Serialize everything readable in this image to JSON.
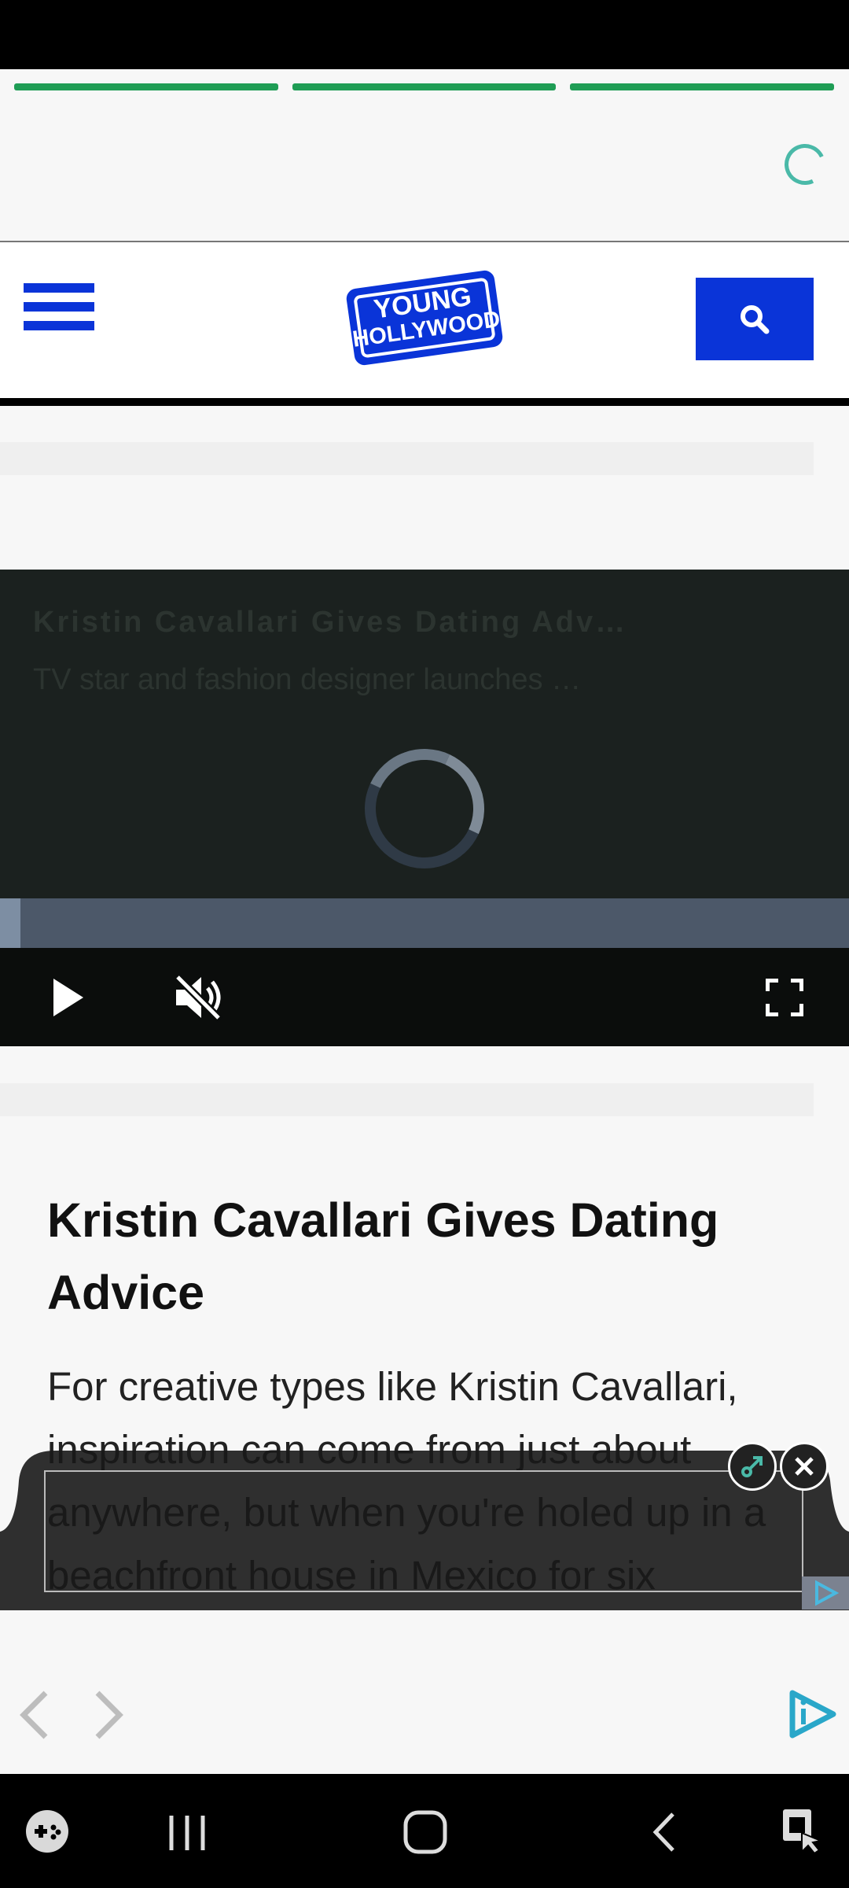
{
  "header": {
    "logo_line1": "YOUNG",
    "logo_line2": "HOLLYWOOD"
  },
  "video": {
    "title": "Kristin Cavallari Gives Dating Adv…",
    "description": "TV star and fashion designer launches …",
    "progress": 0.024,
    "muted": true
  },
  "article": {
    "title": "Kristin Cavallari Gives Dating Advice",
    "body": "For creative types like Kristin Cavallari, inspiration can come from just about anywhere, but when you're holed up in a beachfront house in Mexico for six"
  },
  "icons": {
    "menu": "hamburger-icon",
    "search": "search-icon",
    "play": "play-icon",
    "mute": "volume-muted-icon",
    "fullscreen": "fullscreen-icon",
    "ad_expand": "expand-arrow-icon",
    "ad_close": "close-icon",
    "adchoices": "adchoices-icon",
    "back": "chevron-left-icon",
    "forward": "chevron-right-icon",
    "brand": "brand-play-icon",
    "game": "game-launcher-icon",
    "recents": "recents-icon",
    "home": "home-icon",
    "sys_back": "back-icon",
    "assist": "accessibility-icon"
  },
  "colors": {
    "brand_blue": "#0a34d8",
    "story_progress": "#1f9d55",
    "accent_teal": "#4ab9a8"
  }
}
